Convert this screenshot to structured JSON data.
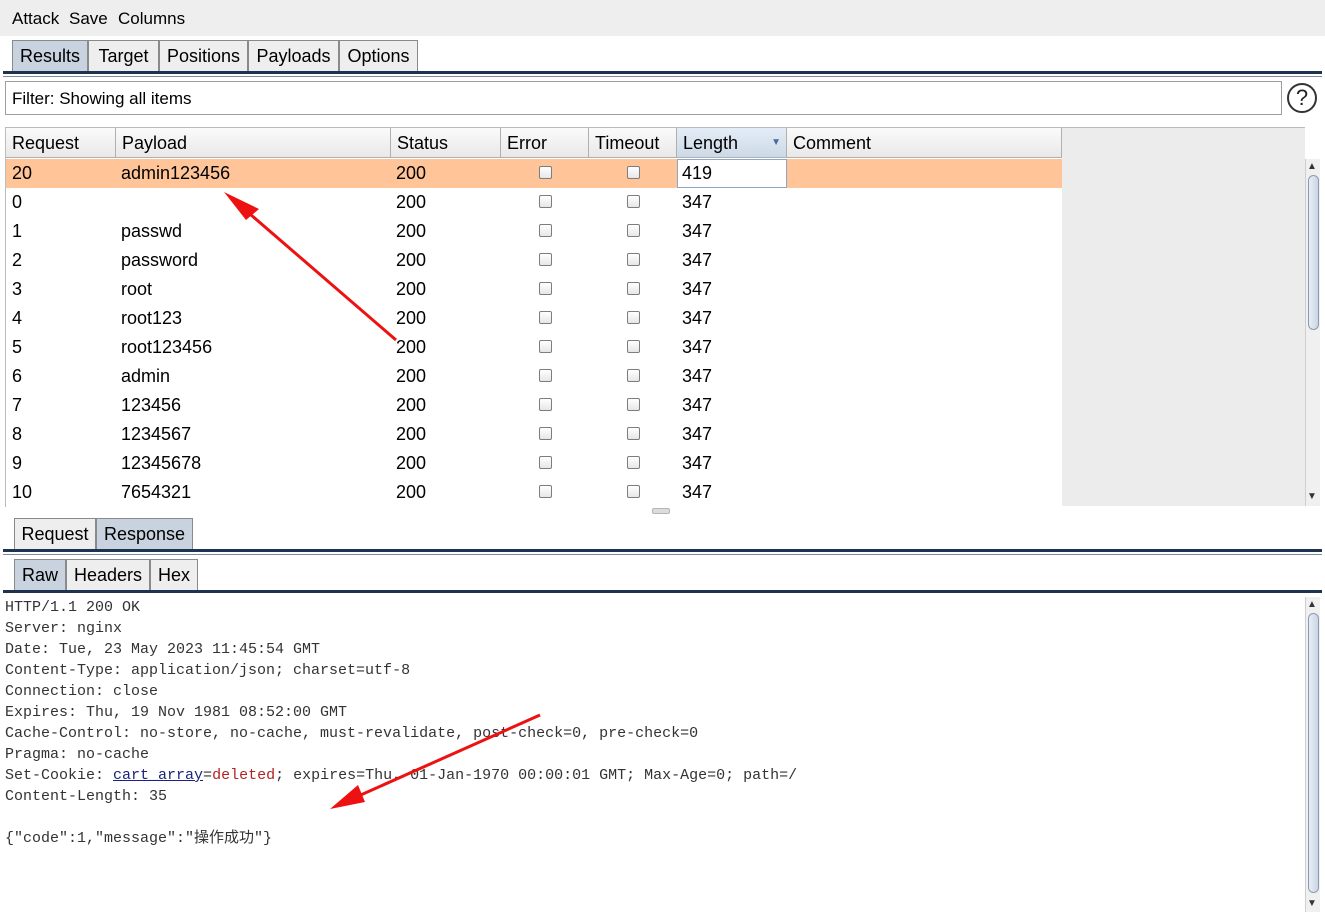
{
  "menu": [
    "Attack",
    "Save",
    "Columns"
  ],
  "main_tabs": [
    "Results",
    "Target",
    "Positions",
    "Payloads",
    "Options"
  ],
  "filter_text": "Filter: Showing all items",
  "help_glyph": "?",
  "table": {
    "columns": [
      "Request",
      "Payload",
      "Status",
      "Error",
      "Timeout",
      "Length",
      "Comment"
    ],
    "sorted_column": "Length",
    "rows": [
      {
        "request": "20",
        "payload": "admin123456",
        "status": "200",
        "length": "419"
      },
      {
        "request": "0",
        "payload": "",
        "status": "200",
        "length": "347"
      },
      {
        "request": "1",
        "payload": "passwd",
        "status": "200",
        "length": "347"
      },
      {
        "request": "2",
        "payload": "password",
        "status": "200",
        "length": "347"
      },
      {
        "request": "3",
        "payload": "root",
        "status": "200",
        "length": "347"
      },
      {
        "request": "4",
        "payload": "root123",
        "status": "200",
        "length": "347"
      },
      {
        "request": "5",
        "payload": "root123456",
        "status": "200",
        "length": "347"
      },
      {
        "request": "6",
        "payload": "admin",
        "status": "200",
        "length": "347"
      },
      {
        "request": "7",
        "payload": "123456",
        "status": "200",
        "length": "347"
      },
      {
        "request": "8",
        "payload": "1234567",
        "status": "200",
        "length": "347"
      },
      {
        "request": "9",
        "payload": "12345678",
        "status": "200",
        "length": "347"
      },
      {
        "request": "10",
        "payload": "7654321",
        "status": "200",
        "length": "347"
      }
    ]
  },
  "detail_tabs": [
    "Request",
    "Response"
  ],
  "view_tabs": [
    "Raw",
    "Headers",
    "Hex"
  ],
  "response": {
    "lines": [
      "HTTP/1.1 200 OK",
      "Server: nginx",
      "Date: Tue, 23 May 2023 11:45:54 GMT",
      "Content-Type: application/json; charset=utf-8",
      "Connection: close",
      "Expires: Thu, 19 Nov 1981 08:52:00 GMT",
      "Cache-Control: no-store, no-cache, must-revalidate, post-check=0, pre-check=0",
      "Pragma: no-cache"
    ],
    "set_cookie": {
      "prefix": "Set-Cookie: ",
      "name": "cart_array",
      "eq": "=",
      "value": "deleted",
      "rest": "; expires=Thu, 01-Jan-1970 00:00:01 GMT; Max-Age=0; path=/"
    },
    "content_length": "Content-Length: 35",
    "body": "{\"code\":1,\"message\":\"操作成功\"}"
  },
  "colors": {
    "selected_row": "#ffc599",
    "annotation_arrow": "#ee1111",
    "active_tab": "#c9d3df"
  }
}
